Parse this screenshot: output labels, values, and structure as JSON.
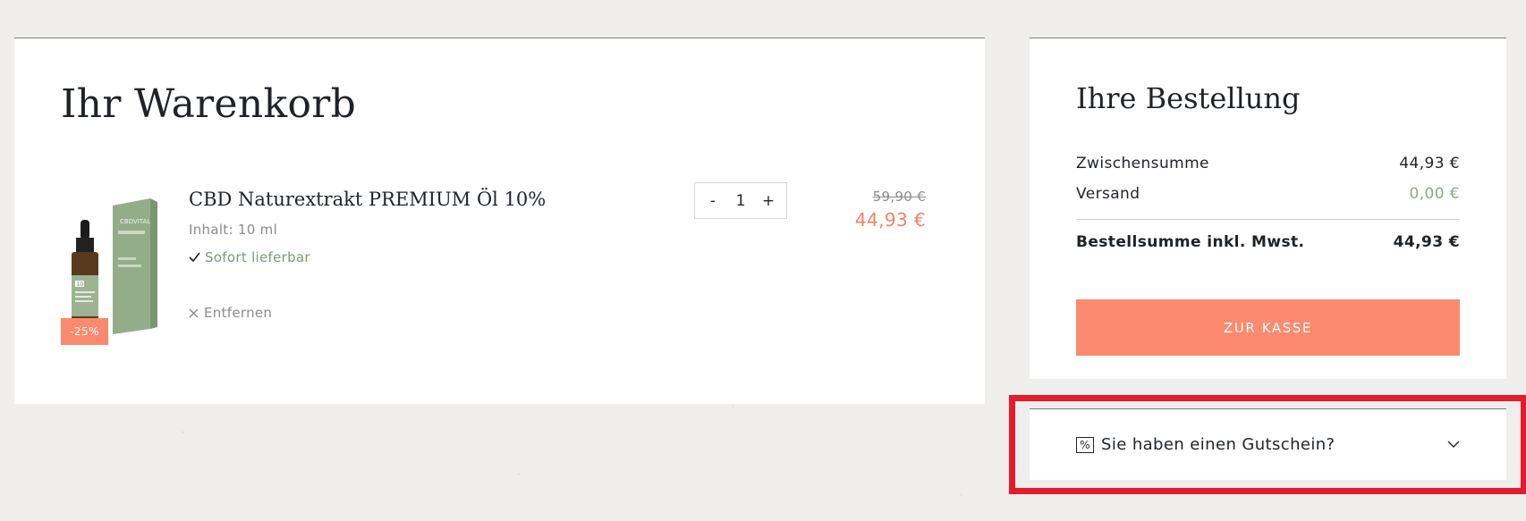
{
  "cart": {
    "title": "Ihr Warenkorb",
    "item": {
      "name": "CBD Naturextrakt PREMIUM Öl 10%",
      "content": "Inhalt: 10 ml",
      "stock": "Sofort lieferbar",
      "remove_label": "Entfernen",
      "badge": "-25%",
      "quantity": "1",
      "qty_minus": "-",
      "qty_plus": "+",
      "price_old": "59,90 €",
      "price_new": "44,93 €",
      "image_brand": "CBDVITAL",
      "image_number": "10"
    }
  },
  "order": {
    "title": "Ihre Bestellung",
    "subtotal_label": "Zwischensumme",
    "subtotal_value": "44,93 €",
    "shipping_label": "Versand",
    "shipping_value": "0,00 €",
    "total_label": "Bestellsumme inkl. Mwst.",
    "total_value": "44,93 €",
    "checkout_label": "ZUR KASSE"
  },
  "voucher": {
    "icon_symbol": "%",
    "label": "Sie haben einen Gutschein?"
  },
  "colors": {
    "accent": "#fc8a6e",
    "price_sale": "#f0826a",
    "stock_green": "#7f9a72",
    "highlight": "#e31c2b"
  },
  "icons": {
    "check": "check-icon",
    "remove": "close-icon",
    "voucher": "percent-icon",
    "expand": "chevron-down-icon"
  }
}
